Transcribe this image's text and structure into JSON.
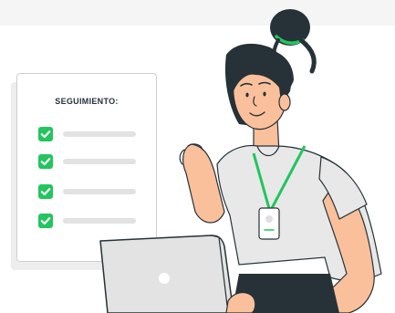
{
  "checklist": {
    "title": "SEGUIMIENTO:",
    "item_count": 4,
    "accent_color": "#22c55e"
  },
  "illustration": {
    "subject": "woman-with-laptop-icon",
    "lanyard_color": "#22c55e"
  }
}
